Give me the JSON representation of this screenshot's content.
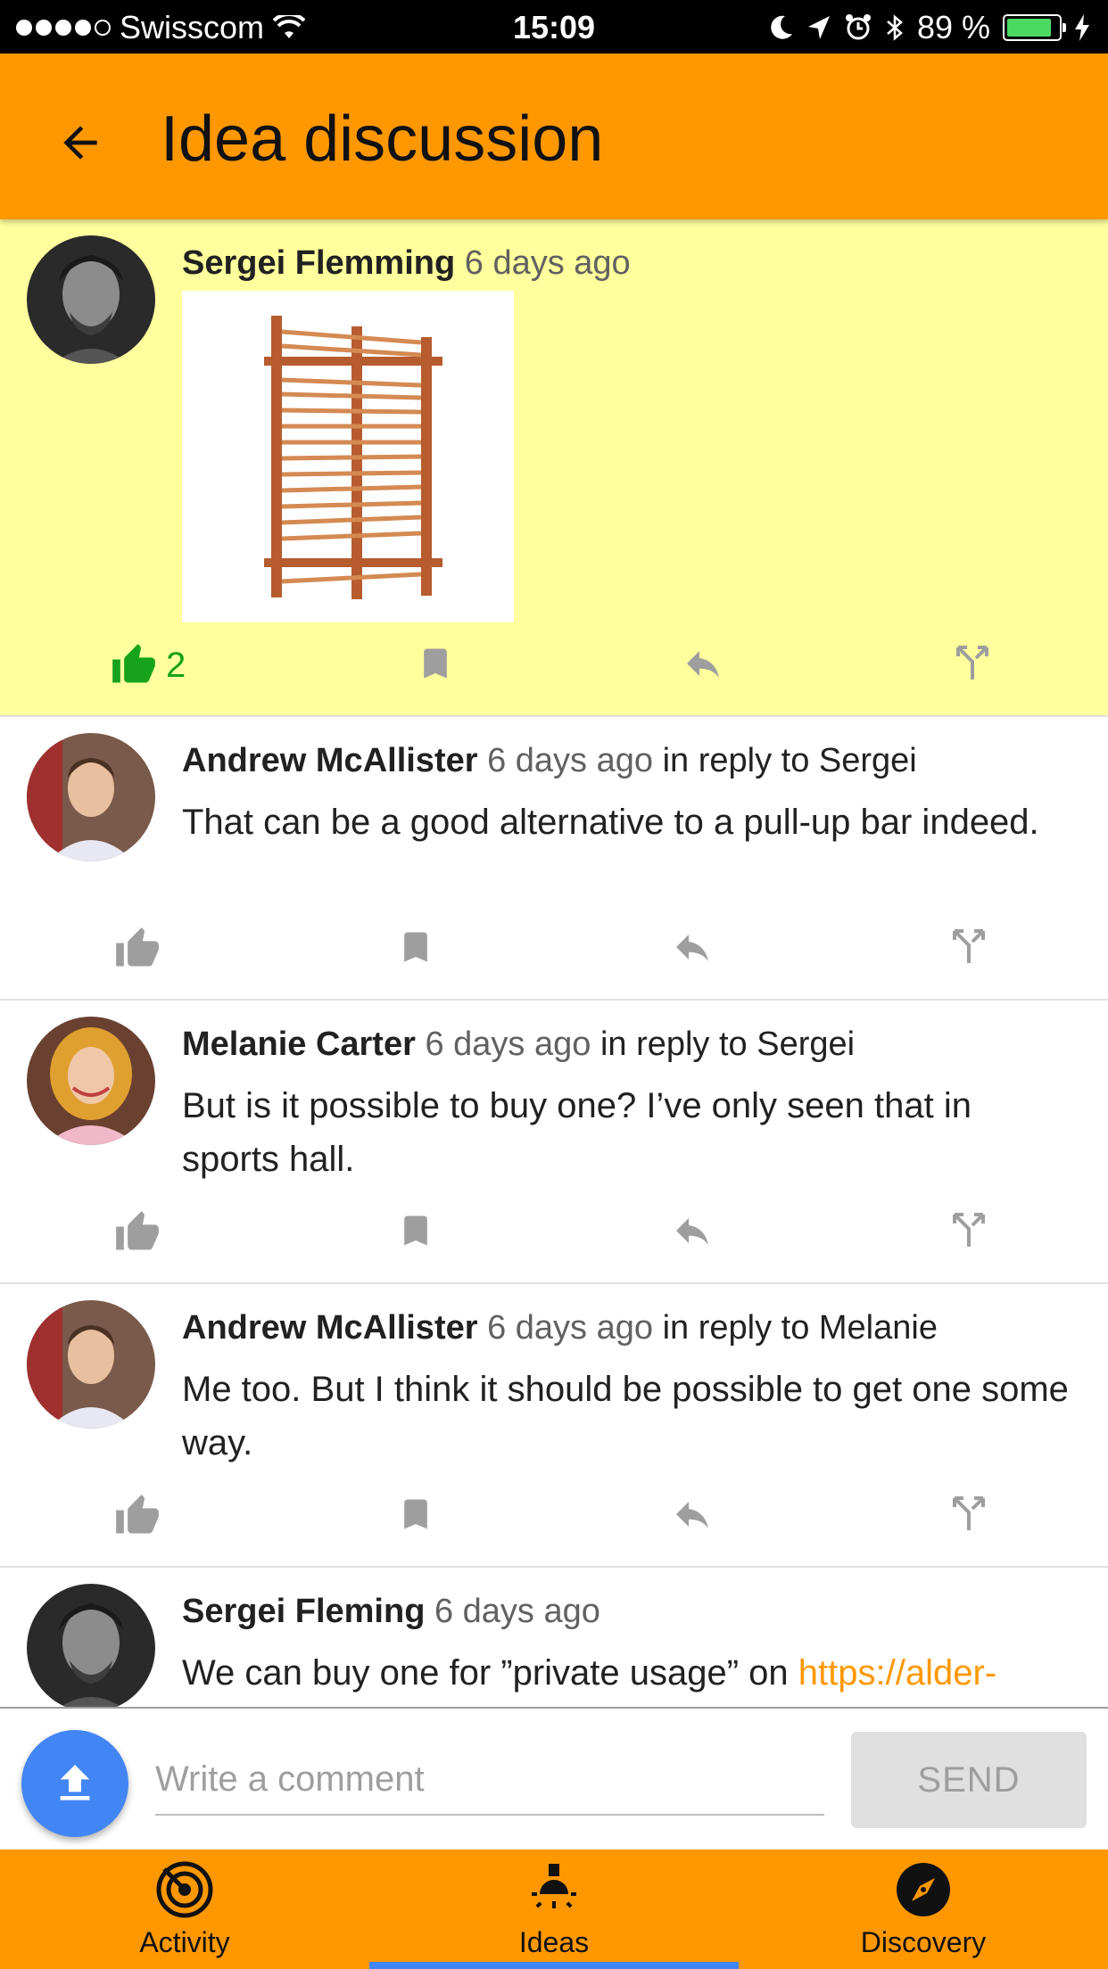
{
  "status_bar": {
    "carrier": "Swisscom",
    "time": "15:09",
    "battery": "89 %"
  },
  "header": {
    "title": "Idea discussion"
  },
  "posts": [
    {
      "author": "Sergei Flemming",
      "time": "6 days ago",
      "reply_to": "",
      "text": "",
      "likes": "2"
    },
    {
      "author": "Andrew McAllister",
      "time": "6 days ago",
      "reply_to": "in reply to Sergei",
      "text": "That can be a good alternative to a pull-up bar indeed."
    },
    {
      "author": "Melanie Carter",
      "time": "6 days ago",
      "reply_to": "in reply to Sergei",
      "text": "But is it possible to buy one? I’ve only seen that in sports hall."
    },
    {
      "author": "Andrew McAllister",
      "time": "6 days ago",
      "reply_to": "in reply to Melanie",
      "text": "Me too. But I think it should be possible to get one some way."
    },
    {
      "author": "Sergei Fleming",
      "time": "6 days ago",
      "reply_to": "",
      "text": "We can buy one for ”private usage” on ",
      "link": "https://alder-"
    }
  ],
  "composer": {
    "placeholder": "Write a comment",
    "send_label": "SEND"
  },
  "bottom_nav": [
    {
      "label": "Activity",
      "icon": "activity-icon"
    },
    {
      "label": "Ideas",
      "icon": "lightbulb-icon",
      "active": true
    },
    {
      "label": "Discovery",
      "icon": "compass-icon"
    }
  ],
  "colors": {
    "accent": "#ff9800",
    "highlight": "#ffff9d",
    "like_active": "#16a21a",
    "upload_button": "#4285f4"
  }
}
